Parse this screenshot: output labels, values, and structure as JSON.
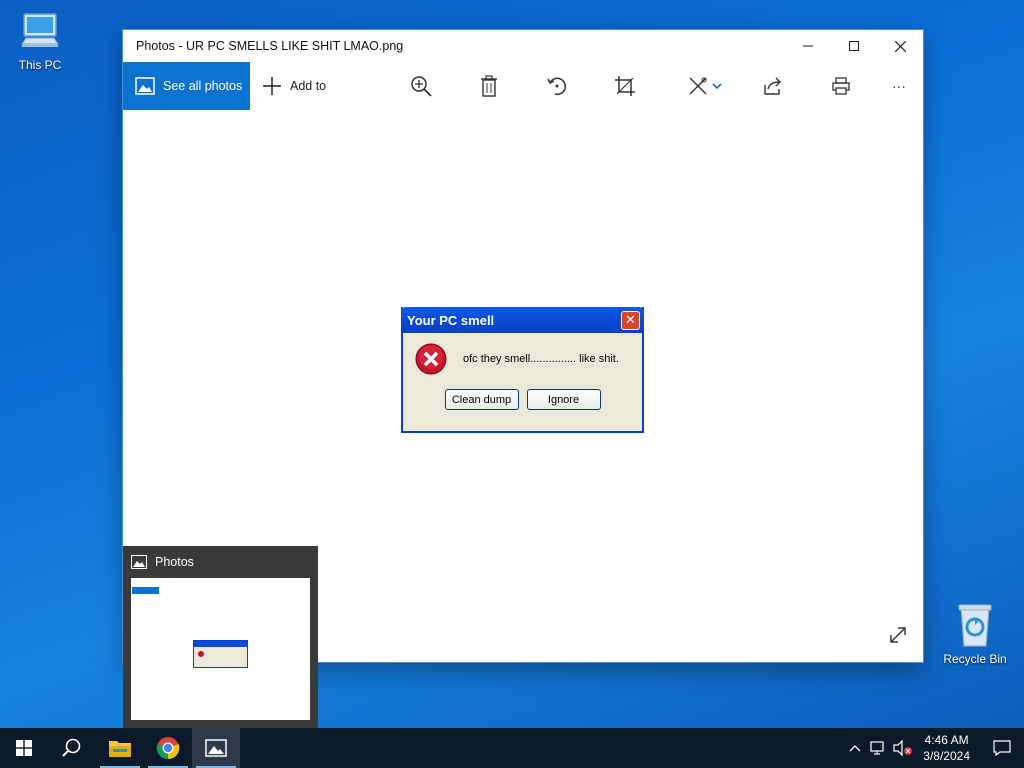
{
  "desktop": {
    "icons": [
      {
        "label": "This PC"
      },
      {
        "label": "Recycle Bin"
      }
    ]
  },
  "window": {
    "title": "Photos - UR PC SMELLS LIKE SHIT LMAO.png",
    "controls": {
      "minimize": "—",
      "maximize": "☐",
      "close": "✕"
    },
    "toolbar": {
      "see_all_label": "See all photos",
      "add_to_label": "Add to",
      "more_label": "···"
    }
  },
  "image_dialog": {
    "title": "Your PC smell",
    "message": "ofc they smell............... like shit.",
    "buttons": [
      "Clean dump",
      "Ignore"
    ]
  },
  "thumbnail": {
    "app_name": "Photos"
  },
  "taskbar": {
    "clock_time": "4:46 AM",
    "clock_date": "3/8/2024"
  },
  "colors": {
    "accent": "#0a73cf",
    "taskbar": "#0b1a2b",
    "xp_title": "#0a4ad6"
  }
}
